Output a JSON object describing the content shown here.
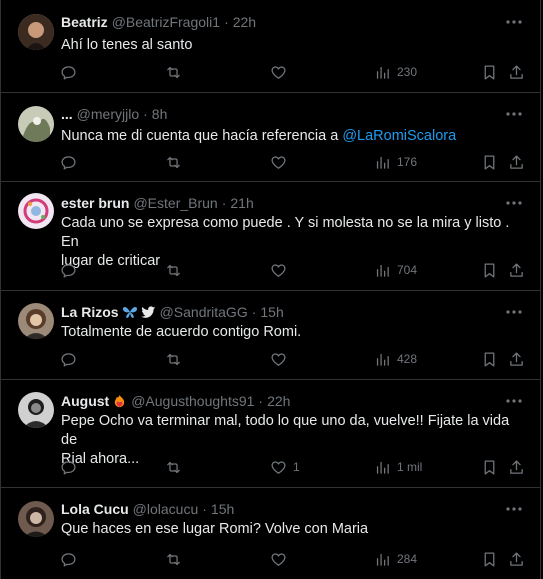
{
  "tweets": [
    {
      "name": "Beatriz",
      "handle": "@BeatrizFragoli1",
      "time": "22h",
      "text": "Ahí lo tenes al santo",
      "replies": "",
      "retweets": "",
      "likes": "",
      "views": "230",
      "avatar_colors": [
        "#5a3b2c",
        "#d9c7b5"
      ]
    },
    {
      "name": "...",
      "handle": "@meryjjlo",
      "time": "8h",
      "text_before": "Nunca me di cuenta que hacía referencia a ",
      "mention": "@LaRomiScalora",
      "replies": "",
      "retweets": "",
      "likes": "",
      "views": "176",
      "avatar_colors": [
        "#6e7a5a",
        "#c8cbb8"
      ]
    },
    {
      "name": "ester brun",
      "handle": "@Ester_Brun",
      "time": "21h",
      "text": "Cada uno se expresa como puede . Y si molesta no se la mira y listo . En\nlugar de criticar",
      "replies": "",
      "retweets": "",
      "likes": "",
      "views": "704",
      "avatar_colors": [
        "#f1e7f2",
        "#d23c7a"
      ]
    },
    {
      "name": "La Rizos",
      "handle": "@SandritaGG",
      "time": "15h",
      "badges": [
        "butterfly-emoji",
        "twitter-bird"
      ],
      "text": "Totalmente de acuerdo contigo Romi.",
      "replies": "",
      "retweets": "",
      "likes": "",
      "views": "428",
      "avatar_colors": [
        "#7d5b43",
        "#e2c6a8"
      ]
    },
    {
      "name": "August",
      "handle": "@Augusthoughts91",
      "time": "22h",
      "badges": [
        "fire-heart-emoji"
      ],
      "text": "Pepe Ocho va terminar mal, todo lo que uno da, vuelve!! Fijate la vida de\nRial ahora...",
      "replies": "",
      "retweets": "",
      "likes": "1",
      "views": "1 mil",
      "avatar_colors": [
        "#2b2b2b",
        "#bdbdbd"
      ]
    },
    {
      "name": "Lola Cucu",
      "handle": "@lolacucu",
      "time": "15h",
      "text": "Que haces en ese lugar Romi? Volve con Maria",
      "replies": "",
      "retweets": "",
      "likes": "",
      "views": "284",
      "avatar_colors": [
        "#4a3a33",
        "#cfb7a6"
      ]
    }
  ],
  "colors": {
    "background": "#000000",
    "text": "#e7e9ea",
    "muted": "#71767b",
    "link": "#1d9bf0",
    "divider": "#2f3336"
  }
}
